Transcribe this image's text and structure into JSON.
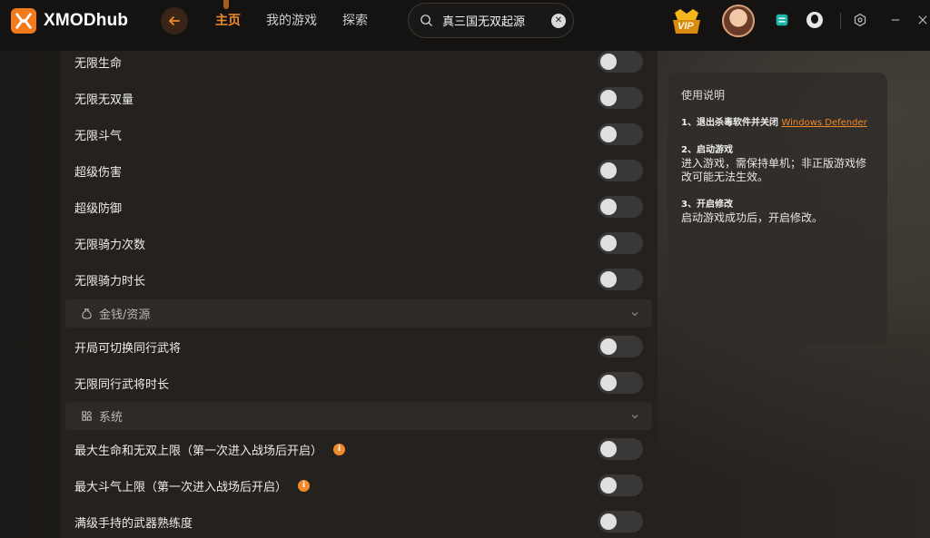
{
  "app": {
    "logo_text": "XMODhub"
  },
  "nav": {
    "items": [
      "主页",
      "我的游戏",
      "探索"
    ],
    "active_index": 0
  },
  "search": {
    "value": "真三国无双起源",
    "placeholder": ""
  },
  "header_icons": [
    "vip-badge-icon",
    "avatar",
    "cube-icon",
    "message-icon",
    "settings-icon",
    "minimize-icon",
    "close-icon"
  ],
  "vip_label": "VIP",
  "cheats_top": [
    {
      "label": "无限生命",
      "on": false
    },
    {
      "label": "无限无双量",
      "on": false
    },
    {
      "label": "无限斗气",
      "on": false
    },
    {
      "label": "超级伤害",
      "on": false
    },
    {
      "label": "超级防御",
      "on": false
    },
    {
      "label": "无限骑力次数",
      "on": false
    },
    {
      "label": "无限骑力时长",
      "on": false
    }
  ],
  "section_money": {
    "label": "金钱/资源"
  },
  "cheats_money": [
    {
      "label": "开局可切换同行武将",
      "on": false
    },
    {
      "label": "无限同行武将时长",
      "on": false
    }
  ],
  "section_system": {
    "label": "系统"
  },
  "cheats_system": [
    {
      "label": "最大生命和无双上限（第一次进入战场后开启）",
      "on": false,
      "info": "i"
    },
    {
      "label": "最大斗气上限（第一次进入战场后开启）",
      "on": false,
      "info": "i"
    },
    {
      "label": "满级手持的武器熟练度",
      "on": false
    }
  ],
  "guide": {
    "title": "使用说明",
    "step1_title": "1、退出杀毒软件并关闭",
    "step1_link": "Windows Defender",
    "step2_title": "2、启动游戏",
    "step2_body": "进入游戏，需保持单机；非正版游戏修改可能无法生效。",
    "step3_title": "3、开启修改",
    "step3_body": "启动游戏成功后，开启修改。"
  },
  "colors": {
    "accent": "#f08a2a",
    "panel": "#24211e",
    "header": "#151312"
  }
}
